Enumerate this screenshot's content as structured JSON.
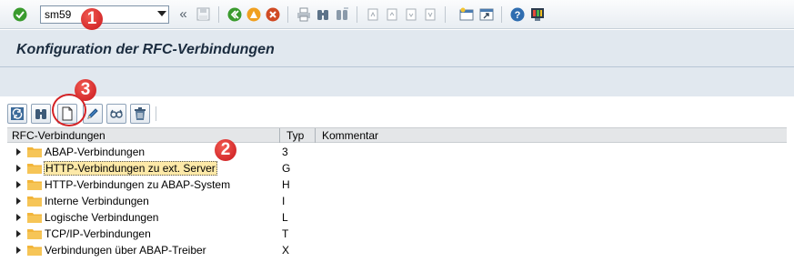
{
  "system_toolbar": {
    "command_field_value": "sm59",
    "icons": [
      "enter-icon",
      "back-double-arrow-icon",
      "save-icon",
      "back-icon",
      "exit-icon",
      "cancel-icon",
      "print-icon",
      "find-icon",
      "find-next-icon",
      "first-page-icon",
      "previous-page-icon",
      "next-page-icon",
      "last-page-icon",
      "create-session-icon",
      "shortcut-icon",
      "help-icon",
      "customize-layout-icon"
    ]
  },
  "title": {
    "text": "Konfiguration der RFC-Verbindungen"
  },
  "app_toolbar": {
    "icons": [
      "refresh-icon",
      "find-icon",
      "create-icon",
      "edit-icon",
      "display-icon",
      "delete-icon"
    ]
  },
  "tree": {
    "columns": [
      "RFC-Verbindungen",
      "Typ",
      "Kommentar"
    ],
    "rows": [
      {
        "label": "ABAP-Verbindungen",
        "typ": "3",
        "comment": ""
      },
      {
        "label": "HTTP-Verbindungen zu ext. Server",
        "typ": "G",
        "comment": ""
      },
      {
        "label": "HTTP-Verbindungen zu ABAP-System",
        "typ": "H",
        "comment": ""
      },
      {
        "label": "Interne Verbindungen",
        "typ": "I",
        "comment": ""
      },
      {
        "label": "Logische Verbindungen",
        "typ": "L",
        "comment": ""
      },
      {
        "label": "TCP/IP-Verbindungen",
        "typ": "T",
        "comment": ""
      },
      {
        "label": "Verbindungen über ABAP-Treiber",
        "typ": "X",
        "comment": ""
      }
    ],
    "selected_row": 1
  },
  "callouts": [
    "1",
    "2",
    "3"
  ],
  "colors": {
    "callout": "#d42124",
    "title_bg": "#e1e8ef",
    "selected_row_bg": "#fde9a8",
    "folder": "#f2b53a"
  }
}
